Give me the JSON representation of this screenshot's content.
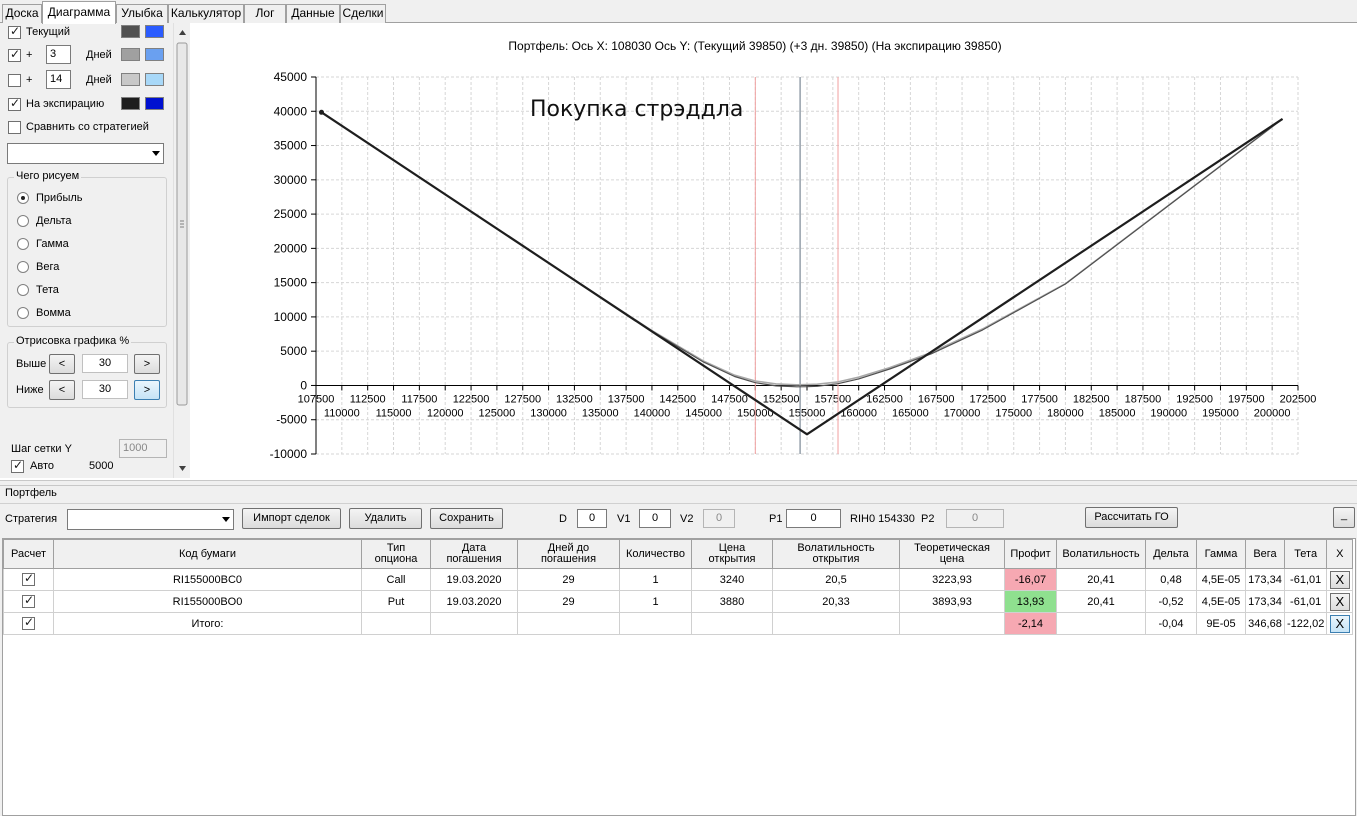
{
  "tabs": [
    {
      "label": "Доска",
      "active": false
    },
    {
      "label": "Диаграмма",
      "active": true
    },
    {
      "label": "Улыбка",
      "active": false
    },
    {
      "label": "Калькулятор",
      "active": false
    },
    {
      "label": "Лог",
      "active": false
    },
    {
      "label": "Данные",
      "active": false
    },
    {
      "label": "Сделки",
      "active": false
    }
  ],
  "left": {
    "current_label": "Текущий",
    "plus": "+",
    "days_label": "Дней",
    "days1": "3",
    "days2": "14",
    "expiry_label": "На экспирацию",
    "compare_label": "Сравнить со стратегией",
    "draw_group_title": "Чего рисуем",
    "radio": [
      "Прибыль",
      "Дельта",
      "Гамма",
      "Вега",
      "Тета",
      "Вомма"
    ],
    "render_group_title": "Отрисовка графика %",
    "above_label": "Выше",
    "below_label": "Ниже",
    "above_value": "30",
    "below_value": "30",
    "arrow_left": "<",
    "arrow_right": ">",
    "grid_step_label": "Шаг сетки Y",
    "grid_step_value": "1000",
    "auto_label": "Авто",
    "auto_value": "5000"
  },
  "colors": {
    "current": [
      "#505050",
      "#2b5cff"
    ],
    "plus3": [
      "#a0a0a0",
      "#6aa0f0"
    ],
    "plus14": [
      "#c8c8c8",
      "#a8d8f8"
    ],
    "expiry": [
      "#1e1e1e",
      "#0010d0"
    ]
  },
  "chart": {
    "header": "Портфель: Ось X: 108030 Ось Y:  (Текущий 39850)  (+3 дн. 39850)  (На экспирацию 39850)",
    "annotation": "Покупка стрэддла"
  },
  "chart_data": {
    "type": "line",
    "title": "Покупка стрэддла",
    "xlim": [
      107500,
      202500
    ],
    "ylim": [
      -10000,
      45000
    ],
    "x_ticks_upper": [
      107500,
      112500,
      117500,
      122500,
      127500,
      132500,
      137500,
      142500,
      147500,
      152500,
      157500,
      162500,
      167500,
      172500,
      177500,
      182500,
      187500,
      192500,
      197500,
      202500
    ],
    "x_ticks_lower": [
      110000,
      115000,
      120000,
      125000,
      130000,
      135000,
      140000,
      145000,
      150000,
      155000,
      160000,
      165000,
      170000,
      175000,
      180000,
      185000,
      190000,
      195000,
      200000
    ],
    "y_ticks": [
      45000,
      40000,
      35000,
      30000,
      25000,
      20000,
      15000,
      10000,
      5000,
      0,
      -5000,
      -10000
    ],
    "grid": true,
    "vertical_lines": [
      {
        "x": 150000,
        "color": "#f0a0a0"
      },
      {
        "x": 154330,
        "color": "#607080"
      },
      {
        "x": 158000,
        "color": "#f0a0a0"
      }
    ],
    "series": [
      {
        "key": "expiry",
        "x": [
          108030,
          155000,
          201000
        ],
        "y": [
          39850,
          -7120,
          38880
        ]
      },
      {
        "key": "current",
        "x": [
          108030,
          130000,
          140000,
          145000,
          148000,
          150000,
          152000,
          154000,
          155000,
          156000,
          158000,
          160000,
          163000,
          167000,
          172000,
          180000,
          201000
        ],
        "y": [
          39850,
          17880,
          7950,
          3400,
          1300,
          400,
          -60,
          -200,
          -180,
          -120,
          250,
          950,
          2400,
          4600,
          8100,
          14800,
          38880
        ]
      },
      {
        "key": "plus3",
        "x": [
          108030,
          130000,
          140000,
          145000,
          148000,
          150000,
          152000,
          154000,
          155000,
          156000,
          158000,
          160000,
          163000,
          167000,
          172000,
          180000,
          201000
        ],
        "y": [
          39850,
          17880,
          8000,
          3550,
          1500,
          650,
          220,
          100,
          120,
          180,
          520,
          1200,
          2600,
          4800,
          8250,
          14850,
          38880
        ]
      }
    ],
    "start_marker": {
      "x": 108030,
      "y": 39850
    }
  },
  "portfolio": {
    "title": "Портфель",
    "strategy_label": "Стратегия",
    "import_btn": "Импорт сделок",
    "delete_btn": "Удалить",
    "save_btn": "Сохранить",
    "d_label": "D",
    "d_value": "0",
    "v1_label": "V1",
    "v1_value": "0",
    "v2_label": "V2",
    "v2_value": "0",
    "p1_label": "P1",
    "p1_value": "0",
    "ticker_text": "RIH0 154330",
    "p2_label": "P2",
    "p2_value": "0",
    "calc_btn": "Рассчитать ГО",
    "min_btn": "_"
  },
  "table": {
    "headers": [
      "Расчет",
      "Код бумаги",
      "Тип опциона",
      "Дата погашения",
      "Дней до погашения",
      "Количество",
      "Цена открытия",
      "Волатильность открытия",
      "Теоретическая цена",
      "Профит",
      "Волатильность",
      "Дельта",
      "Гамма",
      "Вега",
      "Тета",
      "X"
    ],
    "rows": [
      {
        "code": "RI155000BC0",
        "type": "Call",
        "date": "19.03.2020",
        "days": "29",
        "qty": "1",
        "price": "3240",
        "vol_open": "20,5",
        "theo": "3223,93",
        "profit": "-16,07",
        "vol": "20,41",
        "delta": "0,48",
        "gamma": "4,5E-05",
        "vega": "173,34",
        "theta": "-61,01",
        "x": "X"
      },
      {
        "code": "RI155000BO0",
        "type": "Put",
        "date": "19.03.2020",
        "days": "29",
        "qty": "1",
        "price": "3880",
        "vol_open": "20,33",
        "theo": "3893,93",
        "profit": "13,93",
        "vol": "20,41",
        "delta": "-0,52",
        "gamma": "4,5E-05",
        "vega": "173,34",
        "theta": "-61,01",
        "x": "X"
      },
      {
        "code": "Итого:",
        "type": "",
        "date": "",
        "days": "",
        "qty": "",
        "price": "",
        "vol_open": "",
        "theo": "",
        "profit": "-2,14",
        "vol": "",
        "delta": "-0,04",
        "gamma": "9E-05",
        "vega": "346,68",
        "theta": "-122,02",
        "x": "X"
      }
    ]
  }
}
